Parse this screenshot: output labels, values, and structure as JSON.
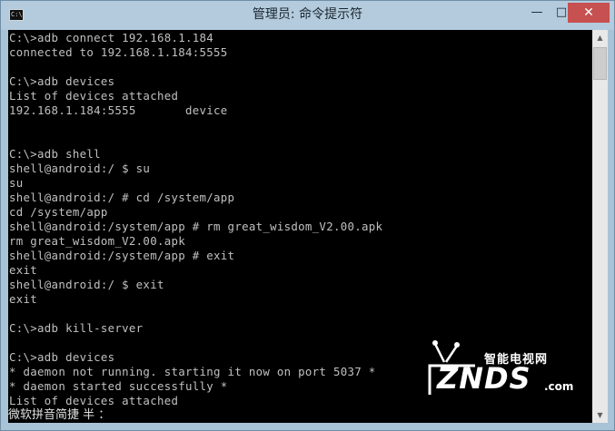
{
  "window": {
    "title": "管理员: 命令提示符",
    "icon_label": "C:\\",
    "buttons": {
      "minimize": "—",
      "maximize": "□",
      "close": "✕"
    }
  },
  "console": {
    "lines": [
      "C:\\>adb connect 192.168.1.184",
      "connected to 192.168.1.184:5555",
      "",
      "C:\\>adb devices",
      "List of devices attached",
      "192.168.1.184:5555       device",
      "",
      "",
      "C:\\>adb shell",
      "shell@android:/ $ su",
      "su",
      "shell@android:/ # cd /system/app",
      "cd /system/app",
      "shell@android:/system/app # rm great_wisdom_V2.00.apk",
      "rm great_wisdom_V2.00.apk",
      "shell@android:/system/app # exit",
      "exit",
      "shell@android:/ $ exit",
      "exit",
      "",
      "C:\\>adb kill-server",
      "",
      "C:\\>adb devices",
      "* daemon not running. starting it now on port 5037 *",
      "* daemon started successfully *",
      "List of devices attached"
    ],
    "ime_status": "微软拼音简捷 半 ："
  },
  "watermark": {
    "brand_cn": "智能电视网",
    "brand": "ZNDS",
    "suffix": ".com"
  },
  "icons": {
    "app": "console-icon",
    "scroll_up": "chevron-up-icon",
    "scroll_down": "chevron-down-icon",
    "watermark_logo": "tv-antenna-icon"
  }
}
